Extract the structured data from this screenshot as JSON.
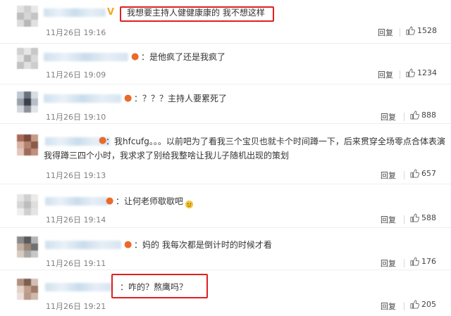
{
  "comments": [
    {
      "badge": "V",
      "text": "：我想要主持人健健康康的 我不想这样",
      "time": "11月26日 19:16",
      "reply": "回复",
      "likes": "1528"
    },
    {
      "badge": "emoji",
      "text": "：是他疯了还是我疯了",
      "time": "11月26日 19:09",
      "reply": "回复",
      "likes": "1234"
    },
    {
      "badge": "emoji",
      "text": "：？？？主持人要累死了",
      "time": "11月26日 19:10",
      "reply": "回复",
      "likes": "888"
    },
    {
      "badge": "emoji",
      "text": "：我hfcufg。。。以前吧为了看我三个宝贝也就卡个时间蹲一下，后来贯穿全场零点合体表演我得蹲三四个小时，我求求了别给我整啥让我儿子随机出现的策划",
      "time": "11月26日 19:13",
      "reply": "回复",
      "likes": "657"
    },
    {
      "badge": "emoji",
      "text": "：让何老师歇歇吧",
      "time": "11月26日 19:14",
      "reply": "回复",
      "likes": "588"
    },
    {
      "badge": "emoji",
      "text": "：妈的 我每次都是倒计时的时候才看",
      "time": "11月26日 19:11",
      "reply": "回复",
      "likes": "176"
    },
    {
      "badge": "",
      "text": "：咋的？熬鹰吗？",
      "time": "11月26日 19:21",
      "reply": "回复",
      "likes": "205"
    }
  ],
  "colors": {
    "highlight": "#e02020",
    "name_blur": "#cfe0ee",
    "badge_v": "#f5a623"
  }
}
